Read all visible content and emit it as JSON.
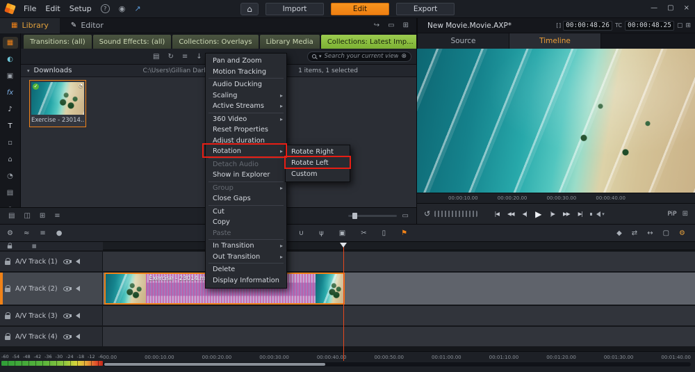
{
  "colors": {
    "accent_orange": "#f08218",
    "tab_green_active": "#8cc63f",
    "annotation_red": "#e81e14",
    "clip_purple": "#b48ac6",
    "playhead_red": "#e8481e"
  },
  "menubar": {
    "menus": [
      {
        "label": "File"
      },
      {
        "label": "Edit"
      },
      {
        "label": "Setup"
      }
    ],
    "help_glyph": "?",
    "location_glyph": "◉",
    "share_glyph": "↗",
    "home_glyph": "⌂",
    "import_label": "Import",
    "edit_label": "Edit",
    "export_label": "Export",
    "win_min": "—",
    "win_max": "▢",
    "win_close": "×"
  },
  "workspace": {
    "library_tab": "Library",
    "library_icon": "▦",
    "editor_tab": "Editor",
    "editor_icon": "✎",
    "panel_icons": [
      {
        "glyph": "↪",
        "name": "send-to-timeline-icon"
      },
      {
        "glyph": "▭",
        "name": "detach-panel-icon"
      },
      {
        "glyph": "⊞",
        "name": "panel-layout-icon"
      }
    ]
  },
  "rail": {
    "items": [
      {
        "glyph": "▦",
        "name": "library-nav-icon"
      },
      {
        "glyph": "◐",
        "name": "web-media-icon"
      },
      {
        "glyph": "▣",
        "name": "photos-icon"
      },
      {
        "glyph": "fx",
        "name": "effects-icon"
      },
      {
        "glyph": "♪",
        "name": "music-icon"
      },
      {
        "glyph": "T",
        "name": "titles-icon"
      },
      {
        "glyph": "▫",
        "name": "montage-icon"
      },
      {
        "glyph": "⌂",
        "name": "projects-icon"
      },
      {
        "glyph": "◔",
        "name": "recent-icon"
      },
      {
        "glyph": "▤",
        "name": "collections-icon"
      },
      {
        "glyph": "◉",
        "name": "sound-icon"
      }
    ]
  },
  "library": {
    "tabs": [
      {
        "label": "Transitions: (all)"
      },
      {
        "label": "Sound Effects: (all)"
      },
      {
        "label": "Collections: Overlays"
      },
      {
        "label": "Library Media"
      },
      {
        "label": "Collections: Latest Imp...",
        "close": "×"
      }
    ],
    "toolbar": {
      "icons": [
        {
          "glyph": "▤",
          "name": "folder-icon"
        },
        {
          "glyph": "↻",
          "name": "refresh-icon"
        },
        {
          "glyph": "≡",
          "name": "view-options-icon"
        },
        {
          "glyph": "↓",
          "name": "sort-icon"
        },
        {
          "glyph": "⇅",
          "name": "order-icon"
        }
      ],
      "search_placeholder": "Search your current view",
      "search_clear": "⊗",
      "search_caret": "▾"
    },
    "group": {
      "collapse": "▾",
      "title": "Downloads",
      "path": "C:\\Users\\Gillian Darby",
      "status": "1 items, 1 selected"
    },
    "clip": {
      "label": "Exercise - 23014...",
      "check": "✓",
      "corner_icon": "◔"
    },
    "footer": {
      "icons": [
        {
          "glyph": "▤",
          "name": "scenes-view-icon"
        },
        {
          "glyph": "◫",
          "name": "thumbnail-view-icon"
        },
        {
          "glyph": "⊞",
          "name": "grid-view-icon"
        },
        {
          "glyph": "≡",
          "name": "list-view-icon"
        }
      ],
      "fit_glyph": "▭"
    }
  },
  "context_menu": {
    "sections": [
      {
        "items": [
          {
            "label": "Pan and Zoom"
          },
          {
            "label": "Motion Tracking"
          }
        ]
      },
      {
        "items": [
          {
            "label": "Audio Ducking"
          },
          {
            "label": "Scaling",
            "submenu": "▸"
          },
          {
            "label": "Active Streams",
            "submenu": "▸"
          }
        ]
      },
      {
        "items": [
          {
            "label": "360 Video",
            "submenu": "▸"
          },
          {
            "label": "Reset Properties"
          },
          {
            "label": "Adjust duration"
          },
          {
            "label": "Rotation",
            "submenu": "▸"
          }
        ]
      },
      {
        "items": [
          {
            "label": "Detach Audio"
          },
          {
            "label": "Show in Explorer"
          }
        ]
      },
      {
        "items": [
          {
            "label": "Group",
            "submenu": "▸"
          },
          {
            "label": "Close Gaps"
          }
        ]
      },
      {
        "items": [
          {
            "label": "Cut"
          },
          {
            "label": "Copy"
          },
          {
            "label": "Paste"
          }
        ]
      },
      {
        "items": [
          {
            "label": "In Transition",
            "submenu": "▸"
          },
          {
            "label": "Out Transition",
            "submenu": "▸"
          }
        ]
      },
      {
        "items": [
          {
            "label": "Delete"
          },
          {
            "label": "Display Information"
          }
        ]
      }
    ],
    "submenu": {
      "items": [
        {
          "label": "Rotate Right"
        },
        {
          "label": "Rotate Left"
        },
        {
          "label": "Custom"
        }
      ]
    }
  },
  "preview": {
    "title": "New Movie.Movie.AXP*",
    "bracket_glyph": "[ ]",
    "tc_in": "00:00:48.26",
    "tc_label": "TC",
    "tc_out": "00:00:48.25",
    "header_icons": [
      {
        "glyph": "▢",
        "name": "undock-preview-icon"
      },
      {
        "glyph": "⊞",
        "name": "preview-grid-icon"
      }
    ],
    "tabs": {
      "source": "Source",
      "timeline": "Timeline"
    },
    "ruler": [
      "00:00:10.00",
      "00:00:20.00",
      "00:00:30.00",
      "00:00:40.00"
    ],
    "transport": {
      "loop_glyph": "↺",
      "buttons": [
        {
          "glyph": "|◀",
          "name": "jump-start-button"
        },
        {
          "glyph": "◀◀",
          "name": "prev-clip-button"
        },
        {
          "glyph": "◀|",
          "name": "frame-back-button"
        },
        {
          "glyph": "▶",
          "name": "play-button"
        },
        {
          "glyph": "|▶",
          "name": "frame-forward-button"
        },
        {
          "glyph": "▶▶",
          "name": "next-clip-button"
        },
        {
          "glyph": "▶|",
          "name": "jump-end-button"
        }
      ],
      "volume_caret": "▾",
      "pip_label": "PiP",
      "grid_glyph": "⊞"
    }
  },
  "tl_toolbar": {
    "left": [
      {
        "glyph": "⚙",
        "name": "timeline-settings-icon"
      },
      {
        "glyph": "≈",
        "name": "audio-mixer-icon"
      },
      {
        "glyph": "≡",
        "name": "track-size-icon"
      },
      {
        "glyph": "●",
        "name": "record-voiceover-icon"
      }
    ],
    "mid": [
      {
        "glyph": "ılı",
        "name": "audio-meter-icon"
      },
      {
        "glyph": "∪",
        "name": "magnet-icon"
      },
      {
        "glyph": "ψ",
        "name": "microphone-icon"
      },
      {
        "glyph": "▣",
        "name": "snapshot-icon"
      },
      {
        "glyph": "✂",
        "name": "razor-icon"
      },
      {
        "glyph": "▯",
        "name": "trash-icon"
      },
      {
        "glyph": "⚑",
        "name": "marker-icon"
      }
    ],
    "right": [
      {
        "glyph": "◆",
        "name": "keyframe-icon"
      },
      {
        "glyph": "⇄",
        "name": "swap-icon"
      },
      {
        "glyph": "↔",
        "name": "trim-mode-icon"
      },
      {
        "glyph": "▢",
        "name": "pip-icon"
      },
      {
        "glyph": "⚙",
        "name": "editor-tools-icon"
      }
    ]
  },
  "timeline": {
    "tracks": [
      {
        "label": "A/V Track (1)"
      },
      {
        "label": "A/V Track (2)"
      },
      {
        "label": "A/V Track (3)"
      },
      {
        "label": "A/V Track (4)"
      }
    ],
    "clip_label": "Exercise - 23014.mp4",
    "ruler": [
      "00.00",
      "00:00:10.00",
      "00:00:20.00",
      "00:00:30.00",
      "00:00:40.00",
      "00:00:50.00",
      "00:01:00.00",
      "00:01:10.00",
      "00:01:20.00",
      "00:01:30.00",
      "00:01:40.00"
    ]
  },
  "meter": {
    "scale": [
      "-60",
      "-54",
      "-48",
      "-42",
      "-36",
      "-30",
      "-24",
      "-18",
      "-12",
      "-6"
    ]
  }
}
